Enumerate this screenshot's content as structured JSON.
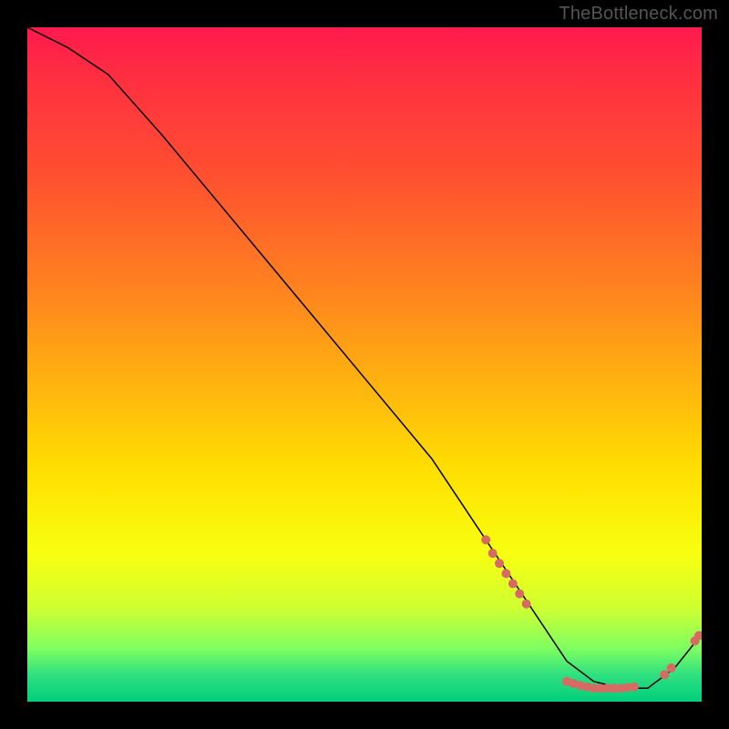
{
  "watermark": "TheBottleneck.com",
  "chart_data": {
    "type": "line",
    "title": "",
    "xlabel": "",
    "ylabel": "",
    "xlim": [
      0,
      100
    ],
    "ylim": [
      0,
      100
    ],
    "series": [
      {
        "name": "curve",
        "x": [
          0,
          6,
          12,
          20,
          30,
          40,
          50,
          60,
          68,
          72,
          76,
          80,
          84,
          88,
          92,
          96,
          100
        ],
        "y": [
          100,
          97,
          93,
          84,
          72,
          60,
          48,
          36,
          24,
          18,
          12,
          6,
          3,
          2,
          2,
          5,
          10
        ]
      }
    ],
    "points": [
      {
        "x": 68.0,
        "y": 24.0
      },
      {
        "x": 69.0,
        "y": 22.0
      },
      {
        "x": 70.0,
        "y": 20.5
      },
      {
        "x": 71.0,
        "y": 19.0
      },
      {
        "x": 72.0,
        "y": 17.5
      },
      {
        "x": 73.0,
        "y": 16.0
      },
      {
        "x": 74.0,
        "y": 14.5
      },
      {
        "x": 80.0,
        "y": 3.0
      },
      {
        "x": 81.0,
        "y": 2.7
      },
      {
        "x": 82.0,
        "y": 2.4
      },
      {
        "x": 83.0,
        "y": 2.2
      },
      {
        "x": 84.0,
        "y": 2.0
      },
      {
        "x": 85.0,
        "y": 2.0
      },
      {
        "x": 86.0,
        "y": 2.0
      },
      {
        "x": 87.0,
        "y": 2.0
      },
      {
        "x": 88.0,
        "y": 2.0
      },
      {
        "x": 89.0,
        "y": 2.1
      },
      {
        "x": 90.0,
        "y": 2.2
      },
      {
        "x": 94.5,
        "y": 4.0
      },
      {
        "x": 95.5,
        "y": 5.0
      },
      {
        "x": 99.0,
        "y": 9.0
      },
      {
        "x": 99.6,
        "y": 9.8
      }
    ],
    "point_radius_px": 5,
    "grid": false,
    "legend": false
  }
}
